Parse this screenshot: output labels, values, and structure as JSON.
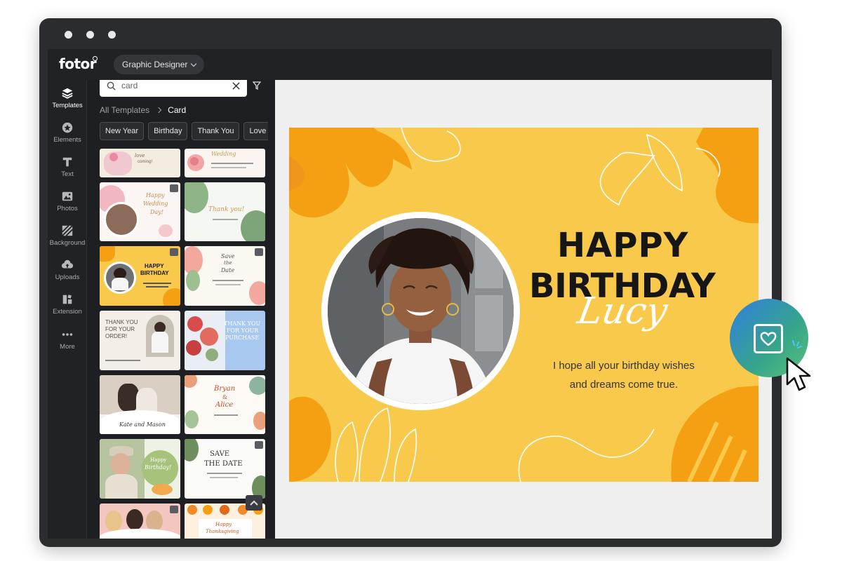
{
  "app": {
    "logo": "fotor",
    "mode_label": "Graphic Designer"
  },
  "sidebar": {
    "items": [
      {
        "label": "Templates",
        "icon": "layers-icon"
      },
      {
        "label": "Elements",
        "icon": "shapes-icon"
      },
      {
        "label": "Text",
        "icon": "text-icon"
      },
      {
        "label": "Photos",
        "icon": "image-icon"
      },
      {
        "label": "Background",
        "icon": "background-icon"
      },
      {
        "label": "Uploads",
        "icon": "cloud-upload-icon"
      },
      {
        "label": "Extension",
        "icon": "extension-icon"
      },
      {
        "label": "More",
        "icon": "more-icon"
      }
    ]
  },
  "panel": {
    "search": {
      "value": "card"
    },
    "breadcrumb": {
      "root": "All Templates",
      "current": "Card"
    },
    "chips": [
      "New Year",
      "Birthday",
      "Thank You",
      "Love"
    ],
    "thumbs": [
      {
        "lines": [
          "love",
          "coming!"
        ]
      },
      {
        "lines": [
          "Wedding"
        ]
      },
      {
        "lines": [
          "Happy",
          "Wedding",
          "Day!"
        ]
      },
      {
        "lines": [
          "Thank you!"
        ]
      },
      {
        "lines": [
          "HAPPY",
          "BIRTHDAY"
        ]
      },
      {
        "lines": [
          "Save",
          "the",
          "Date"
        ]
      },
      {
        "lines": [
          "THANK YOU",
          "FOR YOUR",
          "ORDER!"
        ]
      },
      {
        "lines": [
          "THANK YOU",
          "FOR YOUR",
          "PURCHASE"
        ]
      },
      {
        "lines": [
          "Kate and Mason"
        ]
      },
      {
        "lines": [
          "Bryan",
          "&",
          "Alice"
        ]
      },
      {
        "lines": [
          "Happy",
          "Birthday!"
        ]
      },
      {
        "lines": [
          "SAVE",
          "THE DATE"
        ]
      },
      {
        "lines": []
      },
      {
        "lines": [
          "Happy",
          "Thanksgiving"
        ]
      }
    ]
  },
  "card": {
    "title_line1": "HAPPY",
    "title_line2": "BIRTHDAY",
    "name": "Lucy",
    "message_line1": "I hope all your birthday wishes",
    "message_line2": "and dreams come true."
  },
  "colors": {
    "card_bg": "#f9c94b",
    "accent_orange": "#f5a012",
    "app_bg": "#1d1f23"
  }
}
